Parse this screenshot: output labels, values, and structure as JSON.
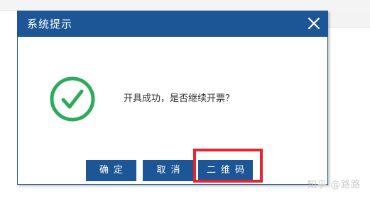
{
  "dialog": {
    "title": "系统提示",
    "close_icon": "close-icon",
    "status_icon": "check-circle-icon",
    "message": "开具成功，是否继续开票？",
    "buttons": {
      "confirm_label": "确定",
      "cancel_label": "取消",
      "qr_label": "二维码"
    }
  },
  "watermark": "知乎 @路路",
  "colors": {
    "title_bar": "#1d5697",
    "button": "#1d5697",
    "success_green": "#2aac5b",
    "highlight_red": "#e8242e"
  }
}
